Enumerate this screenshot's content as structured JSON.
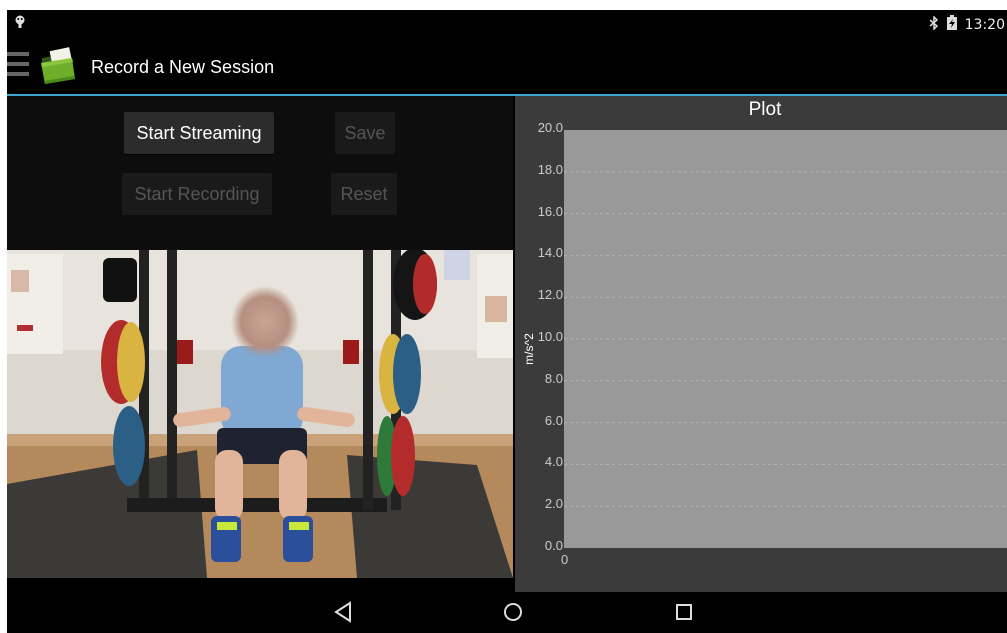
{
  "status_bar": {
    "time": "13:20"
  },
  "action_bar": {
    "title": "Record a New Session"
  },
  "controls": {
    "start_streaming": "Start Streaming",
    "save": "Save",
    "start_recording": "Start Recording",
    "reset": "Reset"
  },
  "plot": {
    "title": "Plot",
    "y_label": "m/s^2",
    "y_ticks": [
      "20.0",
      "18.0",
      "16.0",
      "14.0",
      "12.0",
      "10.0",
      "8.0",
      "6.0",
      "4.0",
      "2.0",
      "0.0"
    ],
    "x_ticks": [
      "0"
    ]
  },
  "chart_data": {
    "type": "line",
    "title": "Plot",
    "xlabel": "",
    "ylabel": "m/s^2",
    "ylim": [
      0,
      20
    ],
    "series": [],
    "grid": true
  }
}
